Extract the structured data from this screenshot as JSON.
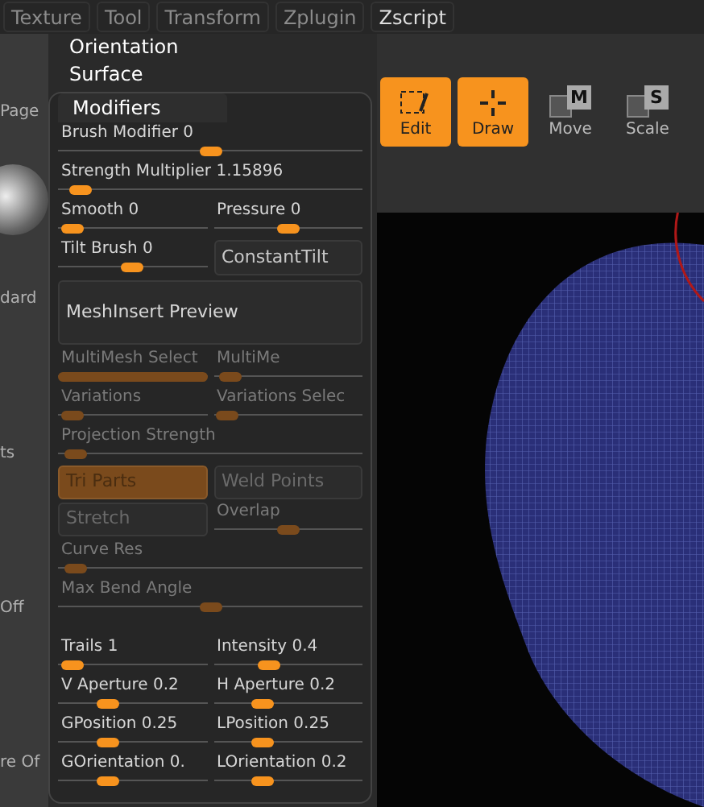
{
  "menu_bar": [
    {
      "label": "Texture",
      "selected": false
    },
    {
      "label": "Tool",
      "selected": false
    },
    {
      "label": "Transform",
      "selected": false
    },
    {
      "label": "Zplugin",
      "selected": false
    },
    {
      "label": "Zscript",
      "selected": true
    }
  ],
  "side_labels": [
    "Page",
    "dard",
    "ts",
    "Off",
    "re Of"
  ],
  "toolbar": [
    {
      "kind": "edit",
      "label": "Edit",
      "selected": true
    },
    {
      "kind": "draw",
      "label": "Draw",
      "selected": true
    },
    {
      "kind": "move",
      "label": "Move",
      "badge": "M",
      "selected": false
    },
    {
      "kind": "scale",
      "label": "Scale",
      "badge": "S",
      "selected": false
    }
  ],
  "panel": {
    "items": [
      "Orientation",
      "Surface"
    ],
    "modifiers": {
      "title": "Modifiers",
      "rows": [
        {
          "cells": [
            {
              "kind": "slider",
              "label": "Brush Modifier 0",
              "level": 0.5,
              "disabled": false
            }
          ]
        },
        {
          "cells": [
            {
              "kind": "slider",
              "label": "Strength Multiplier 1.15896",
              "level": 0.04,
              "disabled": false
            }
          ]
        },
        {
          "cells": [
            {
              "kind": "slider",
              "label": "Smooth 0",
              "level": 0.02,
              "disabled": false
            },
            {
              "kind": "slider",
              "label": "Pressure 0",
              "level": 0.5,
              "disabled": false
            }
          ]
        },
        {
          "cells": [
            {
              "kind": "slider",
              "label": "Tilt Brush 0",
              "level": 0.5,
              "disabled": false
            },
            {
              "kind": "button",
              "label": "ConstantTilt",
              "disabled": false
            }
          ]
        },
        {
          "cells": [
            {
              "kind": "wide_button",
              "label": "MeshInsert Preview",
              "disabled": false
            }
          ]
        },
        {
          "cells": [
            {
              "kind": "slider",
              "label": "MultiMesh Select",
              "level": 1,
              "disabled": true
            },
            {
              "kind": "slider",
              "label": "MultiMe",
              "level": 0.05,
              "disabled": true
            }
          ]
        },
        {
          "cells": [
            {
              "kind": "slider",
              "label": "Variations",
              "level": 0.02,
              "disabled": true
            },
            {
              "kind": "slider",
              "label": "Variations Selec",
              "level": 0.02,
              "disabled": true
            }
          ]
        },
        {
          "cells": [
            {
              "kind": "slider",
              "label": "Projection Strength",
              "level": 0.02,
              "disabled": true
            }
          ]
        },
        {
          "cells": [
            {
              "kind": "toggle",
              "label": "Tri Parts",
              "on": true,
              "disabled": true
            },
            {
              "kind": "toggle",
              "label": "Weld Points",
              "on": false,
              "disabled": true
            }
          ]
        },
        {
          "cells": [
            {
              "kind": "toggle",
              "label": "Stretch",
              "on": false,
              "disabled": true
            },
            {
              "kind": "slider",
              "label": "Overlap",
              "level": 0.5,
              "disabled": true
            }
          ]
        },
        {
          "cells": [
            {
              "kind": "slider",
              "label": "Curve Res",
              "level": 0.02,
              "disabled": true
            }
          ]
        },
        {
          "cells": [
            {
              "kind": "slider",
              "label": "Max Bend Angle",
              "level": 0.5,
              "disabled": true
            }
          ]
        },
        {
          "gap_before": true,
          "cells": [
            {
              "kind": "slider",
              "label": "Trails 1",
              "level": 0.02,
              "disabled": false
            },
            {
              "kind": "slider",
              "label": "Intensity 0.4",
              "level": 0.35,
              "disabled": false
            }
          ]
        },
        {
          "cells": [
            {
              "kind": "slider",
              "label": "V Aperture 0.2",
              "level": 0.3,
              "disabled": false
            },
            {
              "kind": "slider",
              "label": "H Aperture 0.2",
              "level": 0.3,
              "disabled": false
            }
          ]
        },
        {
          "cells": [
            {
              "kind": "slider",
              "label": "GPosition 0.25",
              "level": 0.3,
              "disabled": false
            },
            {
              "kind": "slider",
              "label": "LPosition 0.25",
              "level": 0.3,
              "disabled": false
            }
          ]
        },
        {
          "cells": [
            {
              "kind": "slider",
              "label": "GOrientation 0.",
              "level": 0.3,
              "disabled": false
            },
            {
              "kind": "slider",
              "label": "LOrientation 0.2",
              "level": 0.3,
              "disabled": false
            }
          ]
        }
      ]
    }
  }
}
